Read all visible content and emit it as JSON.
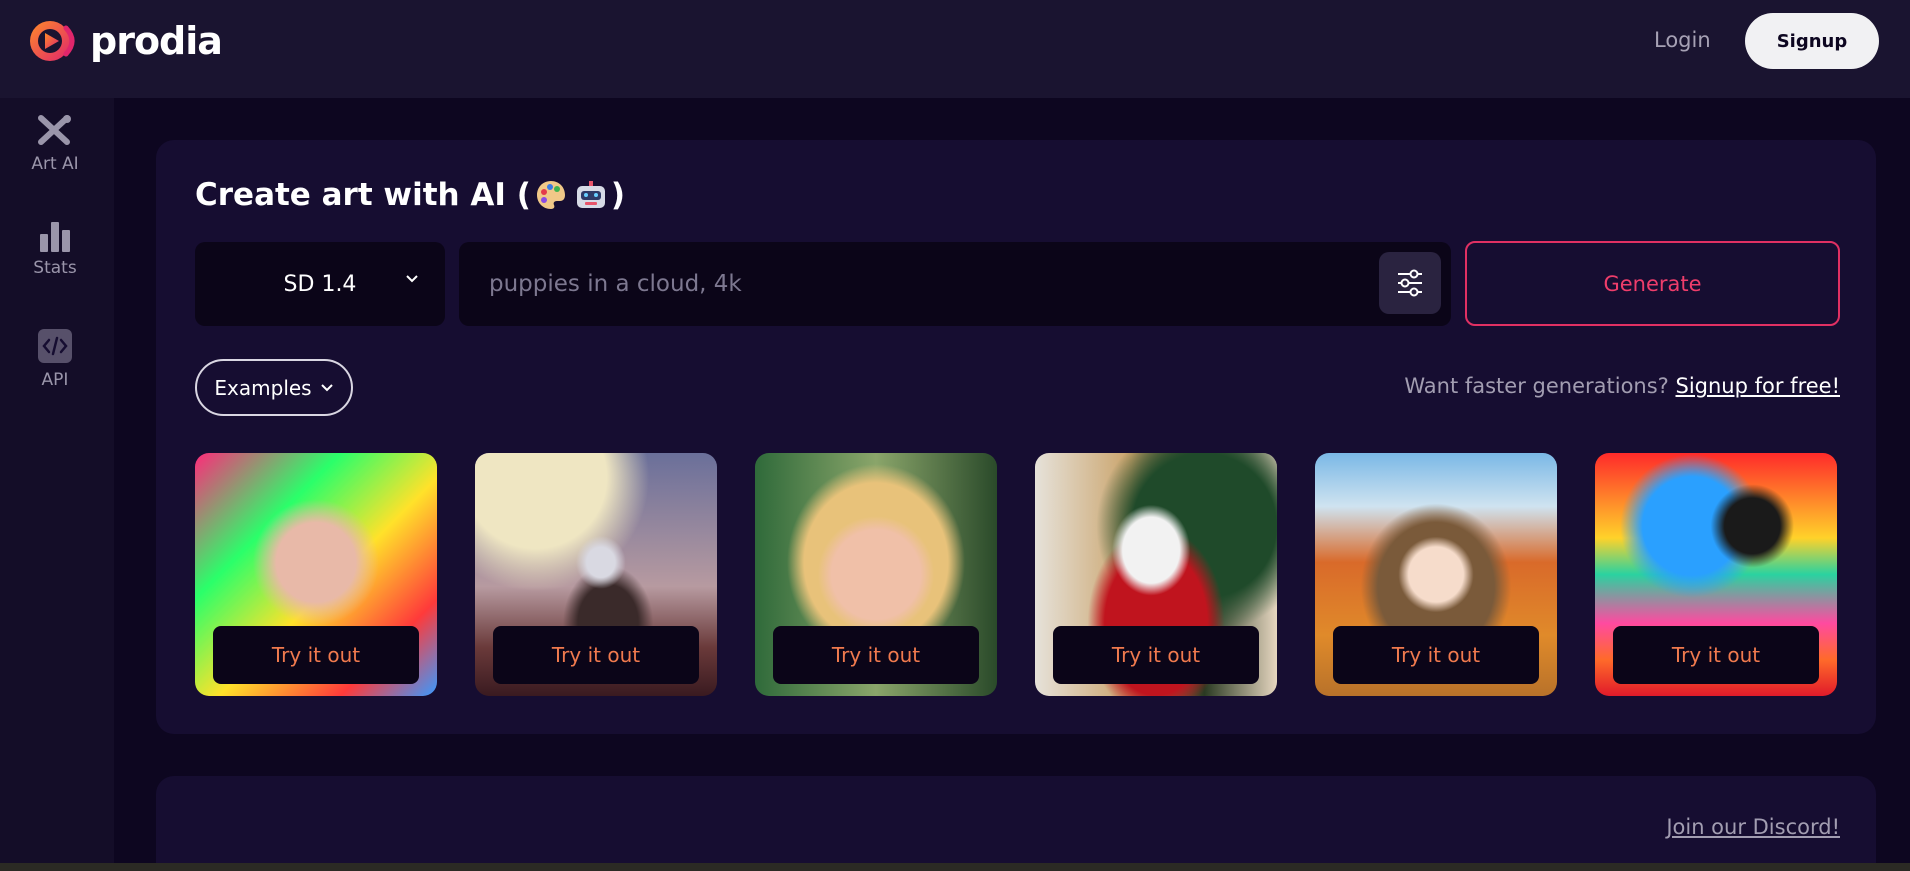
{
  "header": {
    "brand": "prodia",
    "login_label": "Login",
    "signup_label": "Signup"
  },
  "sidebar": {
    "items": [
      {
        "label": "Art AI",
        "icon": "brush-icon"
      },
      {
        "label": "Stats",
        "icon": "bar-chart-icon"
      },
      {
        "label": "API",
        "icon": "code-icon"
      }
    ]
  },
  "main": {
    "title": "Create art with AI (",
    "title_end": ")",
    "title_emojis": [
      "palette-emoji",
      "robot-emoji"
    ],
    "model_value": "SD 1.4",
    "prompt_placeholder": "puppies in a cloud, 4k",
    "prompt_value": "",
    "generate_label": "Generate",
    "examples_label": "Examples",
    "promo_text": "Want faster generations?",
    "promo_link": "Signup for free!",
    "try_label": "Try it out",
    "tiles": [
      {
        "subject": "colorful-woman-portrait"
      },
      {
        "subject": "astronaut-on-horse"
      },
      {
        "subject": "blonde-woman-portrait"
      },
      {
        "subject": "santa-claus"
      },
      {
        "subject": "anime-girl-autumn"
      },
      {
        "subject": "psychedelic-landscape"
      }
    ]
  },
  "footer": {
    "discord_link": "Join our Discord!"
  },
  "colors": {
    "background": "#0d0620",
    "header": "#1a1430",
    "card": "#160d31",
    "accent_pink": "#e03063",
    "try_text": "#f07a4e"
  }
}
